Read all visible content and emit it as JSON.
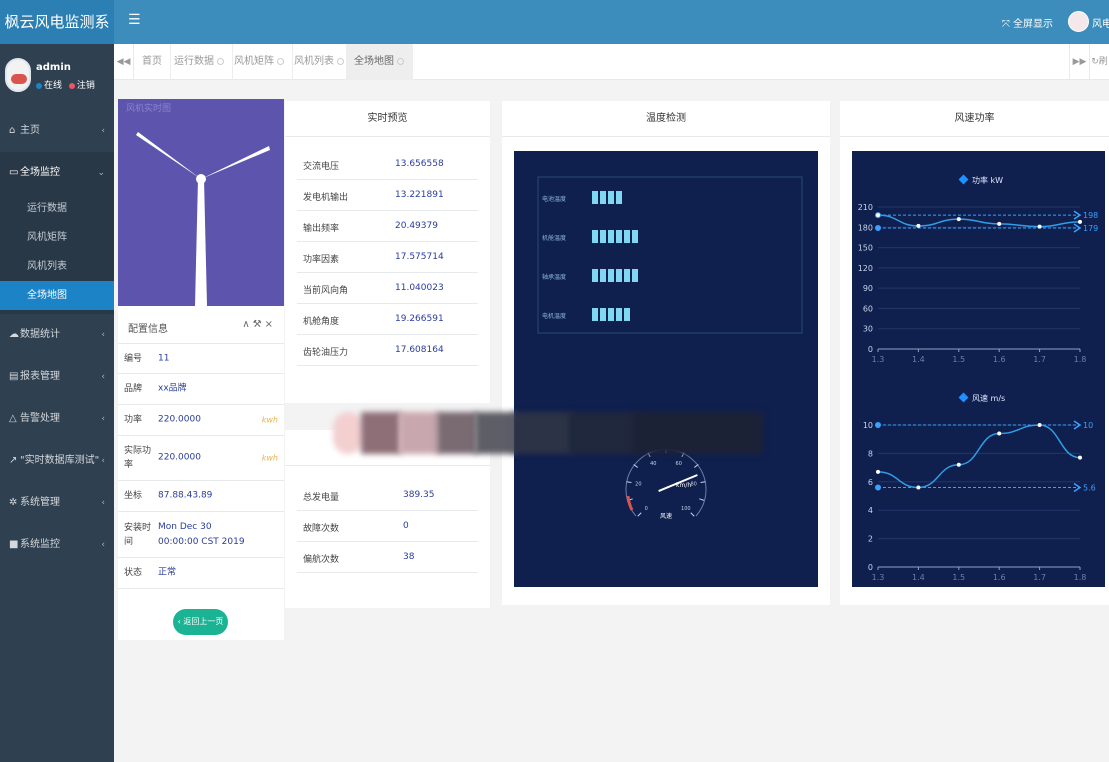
{
  "app": {
    "title": "枫云风电监测系"
  },
  "user": {
    "name": "admin",
    "online": "在线",
    "logout": "注销"
  },
  "sidebar": {
    "items": [
      {
        "label": "主页"
      },
      {
        "label": "全场监控"
      },
      {
        "label": "数据统计"
      },
      {
        "label": "报表管理"
      },
      {
        "label": "告警处理"
      },
      {
        "label": "\"实时数据库测试\""
      },
      {
        "label": "系统管理"
      },
      {
        "label": "系统监控"
      }
    ],
    "sub": [
      {
        "label": "运行数据"
      },
      {
        "label": "风机矩阵"
      },
      {
        "label": "风机列表"
      },
      {
        "label": "全场地图"
      }
    ]
  },
  "topbar": {
    "fullscreen": "全屏显示",
    "user": "风电"
  },
  "tabs": [
    {
      "label": "首页"
    },
    {
      "label": "运行数据"
    },
    {
      "label": "风机矩阵"
    },
    {
      "label": "风机列表"
    },
    {
      "label": "全场地图"
    }
  ],
  "tabs_right": {
    "refresh": "刷"
  },
  "turbine": {
    "label": "风机实时图"
  },
  "config": {
    "title": "配置信息",
    "rows": [
      {
        "key": "编号",
        "value": "11",
        "unit": ""
      },
      {
        "key": "品牌",
        "value": "xx品牌",
        "unit": ""
      },
      {
        "key": "功率",
        "value": "220.0000",
        "unit": "kwh"
      },
      {
        "key": "实际功率",
        "value": "220.0000",
        "unit": "kwh"
      },
      {
        "key": "坐标",
        "value": "87.88.43.89",
        "unit": ""
      },
      {
        "key": "安装时间",
        "value": "Mon Dec 30 00:00:00 CST 2019",
        "unit": ""
      },
      {
        "key": "状态",
        "value": "正常",
        "unit": ""
      }
    ],
    "back": "返回上一页"
  },
  "realtime": {
    "title": "实时预览",
    "rows": [
      {
        "key": "交流电压",
        "value": "13.656558"
      },
      {
        "key": "发电机输出",
        "value": "13.221891"
      },
      {
        "key": "输出频率",
        "value": "20.49379"
      },
      {
        "key": "功率因素",
        "value": "17.575714"
      },
      {
        "key": "当前风向角",
        "value": "11.040023"
      },
      {
        "key": "机舱角度",
        "value": "19.266591"
      },
      {
        "key": "齿轮油压力",
        "value": "17.608164"
      }
    ]
  },
  "stats": {
    "rows": [
      {
        "key": "总发电量",
        "value": "389.35"
      },
      {
        "key": "故障次数",
        "value": "0"
      },
      {
        "key": "偏航次数",
        "value": "38"
      }
    ]
  },
  "temperature": {
    "title": "温度检测",
    "bars": [
      {
        "label": "电池温度",
        "level": 4
      },
      {
        "label": "机舱温度",
        "level": 6
      },
      {
        "label": "轴承温度",
        "level": 6
      },
      {
        "label": "电机温度",
        "level": 5
      }
    ],
    "gauge": {
      "unit": "km/h",
      "label": "风速",
      "ticks": [
        "0",
        "10",
        "20",
        "30",
        "40",
        "50",
        "60",
        "70",
        "80",
        "90",
        "100"
      ],
      "value": 75
    }
  },
  "power": {
    "title": "风速功率"
  },
  "chart_data": [
    {
      "type": "line",
      "title": "",
      "legend": "功率 kW",
      "x": [
        "1.3",
        "1.4",
        "1.5",
        "1.6",
        "1.7",
        "1.8"
      ],
      "y": [
        198,
        182,
        192,
        185,
        181,
        188
      ],
      "ylim": [
        0,
        210
      ],
      "yticks": [
        "0",
        "30",
        "60",
        "90",
        "120",
        "150",
        "180",
        "210"
      ],
      "markers": [
        {
          "label": "198",
          "value": 198
        },
        {
          "label": "179",
          "value": 179
        }
      ]
    },
    {
      "type": "line",
      "title": "",
      "legend": "风速 m/s",
      "x": [
        "1.3",
        "1.4",
        "1.5",
        "1.6",
        "1.7",
        "1.8"
      ],
      "y": [
        6.7,
        5.6,
        7.2,
        9.4,
        10,
        7.7
      ],
      "ylim": [
        0,
        10
      ],
      "yticks": [
        "0",
        "2",
        "4",
        "6",
        "8",
        "10"
      ],
      "markers": [
        {
          "label": "10",
          "value": 10
        },
        {
          "label": "5.6",
          "value": 5.6
        }
      ]
    }
  ]
}
